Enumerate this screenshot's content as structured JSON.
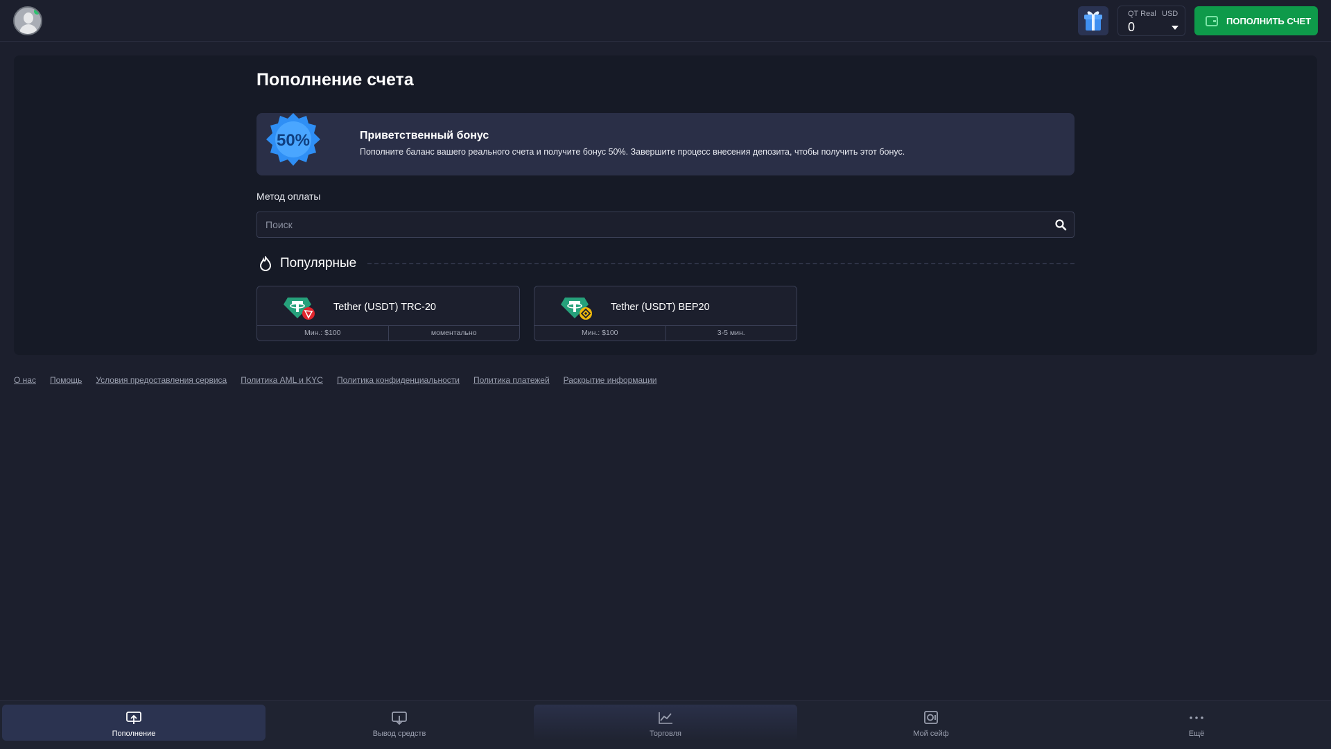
{
  "header": {
    "account_type": "QT Real",
    "currency": "USD",
    "balance": "0",
    "deposit_button": "ПОПОЛНИТЬ СЧЕТ"
  },
  "page": {
    "title": "Пополнение счета"
  },
  "bonus": {
    "badge_text": "50%",
    "title": "Приветственный бонус",
    "description": "Пополните баланс вашего реального счета и получите бонус 50%. Завершите процесс внесения депозита, чтобы получить этот бонус."
  },
  "payment": {
    "label": "Метод оплаты",
    "search_placeholder": "Поиск",
    "section_title": "Популярные",
    "methods": [
      {
        "name": "Tether (USDT) TRC-20",
        "min": "Мин.: $100",
        "time": "моментально",
        "network_color": "#e0262e"
      },
      {
        "name": "Tether (USDT) BEP20",
        "min": "Мин.: $100",
        "time": "3-5 мин.",
        "network_color": "#f0b90b"
      }
    ]
  },
  "footer_links": [
    "О нас",
    "Помощь",
    "Условия предоставления сервиса",
    "Политика AML и KYC",
    "Политика конфиденциальности",
    "Политика платежей",
    "Раскрытие информации"
  ],
  "bottom_nav": [
    {
      "label": "Пополнение",
      "icon": "deposit-icon",
      "active": true
    },
    {
      "label": "Вывод средств",
      "icon": "withdraw-icon",
      "active": false
    },
    {
      "label": "Торговля",
      "icon": "chart-icon",
      "active": false
    },
    {
      "label": "Мой сейф",
      "icon": "safe-icon",
      "active": false
    },
    {
      "label": "Ещё",
      "icon": "more-icon",
      "active": false
    }
  ],
  "colors": {
    "background": "#1c1f2d",
    "panel": "#161a26",
    "accent_green": "#0e9a4a",
    "tether_green": "#26a17b"
  }
}
